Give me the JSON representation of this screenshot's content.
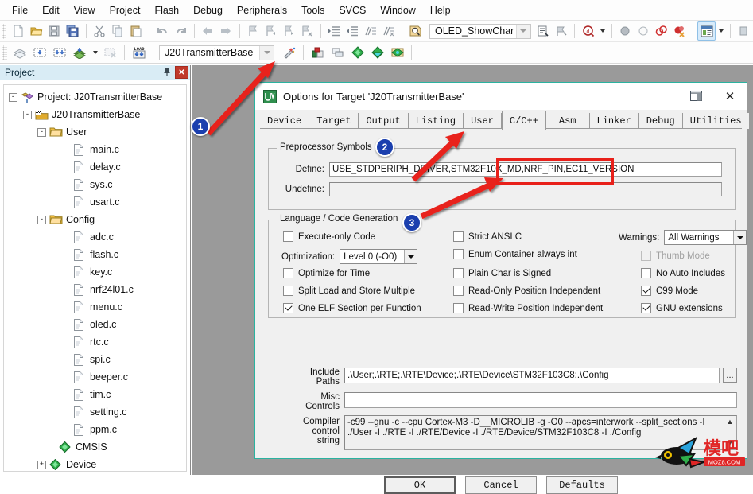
{
  "menu": {
    "items": [
      "File",
      "Edit",
      "View",
      "Project",
      "Flash",
      "Debug",
      "Peripherals",
      "Tools",
      "SVCS",
      "Window",
      "Help"
    ]
  },
  "toolbar_main": {
    "icons": [
      "new-file-icon",
      "open-file-icon",
      "save-icon",
      "save-all-icon",
      "cut-icon",
      "copy-icon",
      "paste-icon",
      "undo-icon",
      "redo-icon",
      "navigate-back-icon",
      "navigate-forward-icon",
      "bookmark-toggle-icon",
      "bookmark-prev-icon",
      "bookmark-next-icon",
      "bookmark-clear-icon",
      "indent-icon",
      "outdent-icon",
      "comment-icon",
      "uncomment-icon"
    ],
    "find_combo_value": "OLED_ShowChar",
    "find_in_files_icon": "find-in-files-icon",
    "bookmark_icon": "insert-bookmark-icon",
    "debug_icon": "start-debug-icon",
    "breakpoint_icons": [
      "breakpoint-icon",
      "breakpoint-disabled-icon",
      "breakpoint-toggle-icon",
      "breakpoint-kill-icon"
    ],
    "window_icon": "window-layout-icon"
  },
  "toolbar_build": {
    "icons": [
      "translate-icon",
      "build-icon",
      "rebuild-icon",
      "batch-build-icon",
      "batch-build-dropdown",
      "stop-build-icon",
      "load-icon"
    ],
    "target_combo_value": "J20TransmitterBase",
    "options_icon": "options-for-target-icon",
    "right_icons": [
      "manage-run-env-icon",
      "multi-project-icon",
      "configure-flash-icon",
      "configure-flash-tools-icon",
      "pack-installer-icon"
    ]
  },
  "project_panel": {
    "title": "Project",
    "pin_icon": "pin-icon",
    "close_icon": "close-icon",
    "tree": [
      {
        "label": "Project: J20TransmitterBase",
        "depth": 0,
        "expander": "-",
        "icon": "project-icon"
      },
      {
        "label": "J20TransmitterBase",
        "depth": 1,
        "expander": "-",
        "icon": "target-icon"
      },
      {
        "label": "User",
        "depth": 2,
        "expander": "-",
        "icon": "folder-icon"
      },
      {
        "label": "main.c",
        "depth": 3,
        "expander": "",
        "icon": "c-file-icon"
      },
      {
        "label": "delay.c",
        "depth": 3,
        "expander": "",
        "icon": "c-file-icon"
      },
      {
        "label": "sys.c",
        "depth": 3,
        "expander": "",
        "icon": "c-file-icon"
      },
      {
        "label": "usart.c",
        "depth": 3,
        "expander": "",
        "icon": "c-file-icon"
      },
      {
        "label": "Config",
        "depth": 2,
        "expander": "-",
        "icon": "folder-icon"
      },
      {
        "label": "adc.c",
        "depth": 3,
        "expander": "",
        "icon": "c-file-icon"
      },
      {
        "label": "flash.c",
        "depth": 3,
        "expander": "",
        "icon": "c-file-icon"
      },
      {
        "label": "key.c",
        "depth": 3,
        "expander": "",
        "icon": "c-file-icon"
      },
      {
        "label": "nrf24l01.c",
        "depth": 3,
        "expander": "",
        "icon": "c-file-icon"
      },
      {
        "label": "menu.c",
        "depth": 3,
        "expander": "",
        "icon": "c-file-icon"
      },
      {
        "label": "oled.c",
        "depth": 3,
        "expander": "",
        "icon": "c-file-icon"
      },
      {
        "label": "rtc.c",
        "depth": 3,
        "expander": "",
        "icon": "c-file-icon"
      },
      {
        "label": "spi.c",
        "depth": 3,
        "expander": "",
        "icon": "c-file-icon"
      },
      {
        "label": "beeper.c",
        "depth": 3,
        "expander": "",
        "icon": "c-file-icon"
      },
      {
        "label": "tim.c",
        "depth": 3,
        "expander": "",
        "icon": "c-file-icon"
      },
      {
        "label": "setting.c",
        "depth": 3,
        "expander": "",
        "icon": "c-file-icon"
      },
      {
        "label": "ppm.c",
        "depth": 3,
        "expander": "",
        "icon": "c-file-icon"
      },
      {
        "label": "CMSIS",
        "depth": 2,
        "expander": "",
        "icon": "component-icon"
      },
      {
        "label": "Device",
        "depth": 2,
        "expander": "+",
        "icon": "component-icon"
      }
    ]
  },
  "dialog": {
    "title": "Options for Target 'J20TransmitterBase'",
    "app_icon": "uvision-icon",
    "restore_icon": "restore-icon",
    "close_icon": "close-icon",
    "tabs": [
      {
        "label": "Device",
        "active": false
      },
      {
        "label": "Target",
        "active": false
      },
      {
        "label": "Output",
        "active": false
      },
      {
        "label": "Listing",
        "active": false
      },
      {
        "label": "User",
        "active": false
      },
      {
        "label": "C/C++",
        "active": true
      },
      {
        "label": "Asm",
        "active": false
      },
      {
        "label": "Linker",
        "active": false
      },
      {
        "label": "Debug",
        "active": false
      },
      {
        "label": "Utilities",
        "active": false
      }
    ],
    "preprocessor": {
      "legend": "Preprocessor Symbols",
      "define_label": "Define:",
      "define_value": "USE_STDPERIPH_DRIVER,STM32F10X_MD,NRF_PIN,EC11_VERSION",
      "undefine_label": "Undefine:",
      "undefine_value": ""
    },
    "codegen": {
      "legend": "Language / Code Generation",
      "left_checks": [
        {
          "label": "Execute-only Code",
          "checked": false,
          "disabled": false
        },
        {
          "label": "Optimize for Time",
          "checked": false,
          "disabled": false
        },
        {
          "label": "Split Load and Store Multiple",
          "checked": false,
          "disabled": false
        },
        {
          "label": "One ELF Section per Function",
          "checked": true,
          "disabled": false
        }
      ],
      "optimization_label": "Optimization:",
      "optimization_value": "Level 0 (-O0)",
      "mid_checks": [
        {
          "label": "Strict ANSI C",
          "checked": false,
          "disabled": false
        },
        {
          "label": "Enum Container always int",
          "checked": false,
          "disabled": false
        },
        {
          "label": "Plain Char is Signed",
          "checked": false,
          "disabled": false
        },
        {
          "label": "Read-Only Position Independent",
          "checked": false,
          "disabled": false
        },
        {
          "label": "Read-Write Position Independent",
          "checked": false,
          "disabled": false
        }
      ],
      "warnings_label": "Warnings:",
      "warnings_value": "All Warnings",
      "right_checks": [
        {
          "label": "Thumb Mode",
          "checked": false,
          "disabled": true
        },
        {
          "label": "No Auto Includes",
          "checked": false,
          "disabled": false
        },
        {
          "label": "C99 Mode",
          "checked": true,
          "disabled": false
        },
        {
          "label": "GNU extensions",
          "checked": true,
          "disabled": false
        }
      ]
    },
    "paths": {
      "include_label_line1": "Include",
      "include_label_line2": "Paths",
      "include_value": ".\\User;.\\RTE;.\\RTE\\Device;.\\RTE\\Device\\STM32F103C8;.\\Config",
      "browse_label": "...",
      "misc_label_line1": "Misc",
      "misc_label_line2": "Controls",
      "misc_value": "",
      "compiler_label_line1": "Compiler",
      "compiler_label_line2": "control",
      "compiler_label_line3": "string",
      "compiler_value": "-c99 --gnu -c --cpu Cortex-M3 -D__MICROLIB -g -O0 --apcs=interwork --split_sections -I ./User -I ./RTE -I ./RTE/Device -I ./RTE/Device/STM32F103C8 -I ./Config"
    },
    "buttons": [
      {
        "label": "OK",
        "default": true
      },
      {
        "label": "Cancel",
        "default": false
      },
      {
        "label": "Defaults",
        "default": false
      }
    ]
  },
  "annotations": {
    "badges": [
      "1",
      "2",
      "3"
    ],
    "highlight_color": "#e8201a",
    "badge_color": "#1b3fae"
  },
  "watermark": {
    "text_cn": "模吧",
    "text_url": "MOZ8.COM",
    "icon": "bird-logo-icon"
  }
}
